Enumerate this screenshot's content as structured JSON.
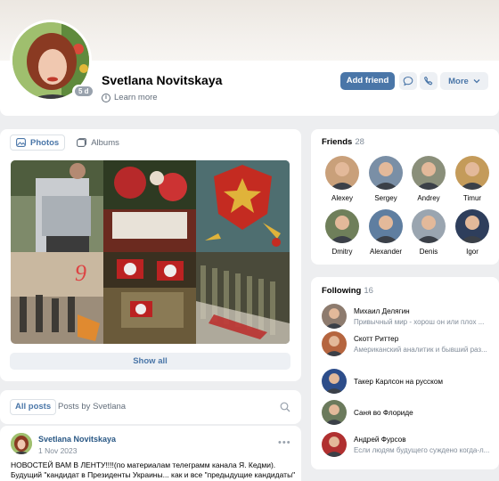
{
  "profile": {
    "name": "Svetlana Novitskaya",
    "online_badge": "5 d",
    "learn_more": "Learn more",
    "add_friend": "Add friend",
    "more": "More"
  },
  "photos": {
    "tabs": [
      "Photos",
      "Albums"
    ],
    "show_all": "Show all"
  },
  "posts": {
    "tab_all": "All posts",
    "tab_by": "Posts by Svetlana",
    "post": {
      "author": "Svetlana Novitskaya",
      "date": "1 Nov 2023",
      "line1": "НОВОСТЕЙ ВАМ В ЛЕНТУ!!!!(по материалам телеграмм канала Я. Кедми).",
      "line2": "Будущий \"кандидат в Президенты Украины... как и все \"предыдущие кандидаты\""
    }
  },
  "friends": {
    "title": "Friends",
    "count": "28",
    "items": [
      {
        "name": "Alexey",
        "icon": "person-avatar",
        "color": "#c9a07a"
      },
      {
        "name": "Sergey",
        "icon": "person-avatar",
        "color": "#7a8fa6"
      },
      {
        "name": "Andrey",
        "icon": "person-avatar",
        "color": "#8a8f7a"
      },
      {
        "name": "Timur",
        "icon": "person-avatar",
        "color": "#c49b5a"
      },
      {
        "name": "Dmitry",
        "icon": "person-avatar",
        "color": "#6f7f5a"
      },
      {
        "name": "Alexander",
        "icon": "person-avatar",
        "color": "#5f7ea0"
      },
      {
        "name": "Denis",
        "icon": "person-avatar",
        "color": "#9aa5b0"
      },
      {
        "name": "Igor",
        "icon": "person-avatar",
        "color": "#2e3e5c"
      }
    ]
  },
  "following": {
    "title": "Following",
    "count": "16",
    "items": [
      {
        "name": "Михаил Делягин",
        "sub": "Привычный мир - хорош он или плох ...",
        "color": "#8d7b6e"
      },
      {
        "name": "Скотт Риттер",
        "sub": "Американский аналитик и бывший раз...",
        "color": "#b5653f"
      },
      {
        "name": "Такер Карлсон на русском",
        "sub": "",
        "color": "#2d4d8a"
      },
      {
        "name": "Саня во Флориде",
        "sub": "",
        "color": "#6b7a5c"
      },
      {
        "name": "Андрей Фурсов",
        "sub": "Если людям будущего суждено когда-л...",
        "color": "#b03030"
      }
    ]
  }
}
